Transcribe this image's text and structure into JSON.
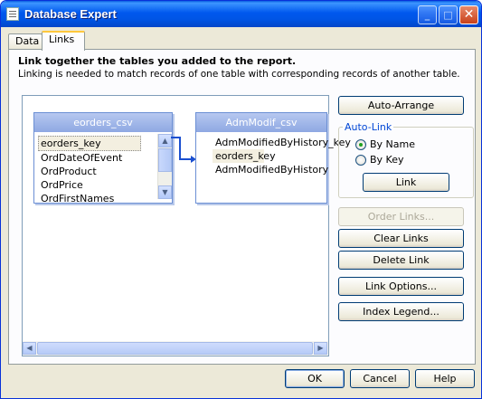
{
  "window": {
    "title": "Database Expert",
    "min_glyph": "_",
    "max_glyph": "□",
    "close_glyph": "✕"
  },
  "tabs": [
    {
      "label": "Data",
      "active": false
    },
    {
      "label": "Links",
      "active": true
    }
  ],
  "header": {
    "heading": "Link together the tables you added to the report.",
    "subheading": "Linking is needed to match records of one table with corresponding records of another table."
  },
  "tables": [
    {
      "name": "eorders_csv",
      "fields": [
        "eorders_key",
        "OrdDateOfEvent",
        "OrdProduct",
        "OrdPrice",
        "OrdFirstNames"
      ]
    },
    {
      "name": "AdmModif_csv",
      "fields": [
        "AdmModifiedByHistory_key",
        "eorders_key",
        "AdmModifiedByHistory"
      ]
    }
  ],
  "scroll": {
    "up": "▲",
    "down": "▼",
    "left": "◀",
    "right": "▶"
  },
  "buttons": {
    "auto_arrange": "Auto-Arrange",
    "link": "Link",
    "order_links": "Order Links...",
    "clear_links": "Clear Links",
    "delete_link": "Delete Link",
    "link_options": "Link Options...",
    "index_legend": "Index Legend...",
    "ok": "OK",
    "cancel": "Cancel",
    "help": "Help"
  },
  "auto_link": {
    "label": "Auto-Link",
    "options": [
      {
        "label": "By Name",
        "checked": true
      },
      {
        "label": "By Key",
        "checked": false
      }
    ]
  }
}
